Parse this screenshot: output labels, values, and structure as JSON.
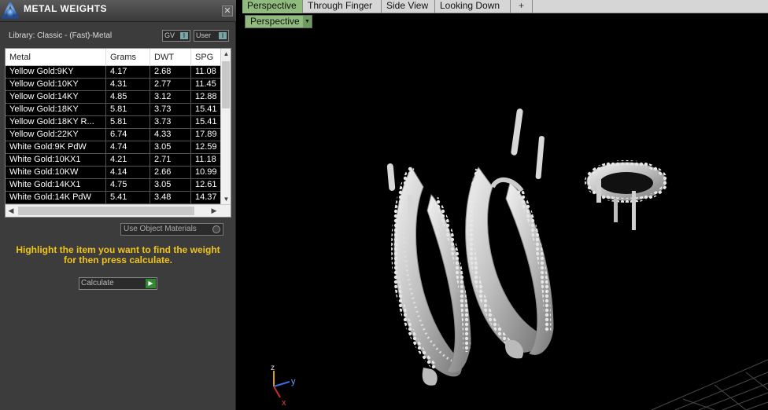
{
  "panel": {
    "title": "METAL WEIGHTS",
    "close": "✕",
    "library_label": "Library: Classic - (Fast)-Metal",
    "gv_select": "GV",
    "user_select": "User",
    "use_object_materials": "Use Object Materials",
    "hint": "Highlight the item you want to find the weight for then press calculate.",
    "calculate": "Calculate"
  },
  "table": {
    "headers": [
      "Metal",
      "Grams",
      "DWT",
      "SPG"
    ],
    "rows": [
      [
        "Yellow Gold:9KY",
        "4.17",
        "2.68",
        "11.08"
      ],
      [
        "Yellow Gold:10KY",
        "4.31",
        "2.77",
        "11.45"
      ],
      [
        "Yellow Gold:14KY",
        "4.85",
        "3.12",
        "12.88"
      ],
      [
        "Yellow Gold:18KY",
        "5.81",
        "3.73",
        "15.41"
      ],
      [
        "Yellow Gold:18KY R...",
        "5.81",
        "3.73",
        "15.41"
      ],
      [
        "Yellow Gold:22KY",
        "6.74",
        "4.33",
        "17.89"
      ],
      [
        "White Gold:9K PdW",
        "4.74",
        "3.05",
        "12.59"
      ],
      [
        "White Gold:10KX1",
        "4.21",
        "2.71",
        "11.18"
      ],
      [
        "White Gold:10KW",
        "4.14",
        "2.66",
        "10.99"
      ],
      [
        "White Gold:14KX1",
        "4.75",
        "3.05",
        "12.61"
      ],
      [
        "White Gold:14K PdW",
        "5.41",
        "3.48",
        "14.37"
      ]
    ]
  },
  "viewport": {
    "tabs": [
      "Perspective",
      "Through Finger",
      "Side View",
      "Looking Down"
    ],
    "add_tab": "+",
    "view_select": "Perspective",
    "axes": {
      "x": "x",
      "y": "y",
      "z": "z"
    }
  },
  "colors": {
    "accent_tab": "#8fbc7d",
    "hint_text": "#f0c419",
    "panel_bg": "#3c3c3c"
  },
  "icons": [
    "app-logo-icon",
    "close-icon",
    "dropdown-arrow-icon",
    "scroll-up-icon",
    "scroll-down-icon",
    "scroll-left-icon",
    "scroll-right-icon",
    "radio-icon",
    "play-arrow-icon"
  ]
}
